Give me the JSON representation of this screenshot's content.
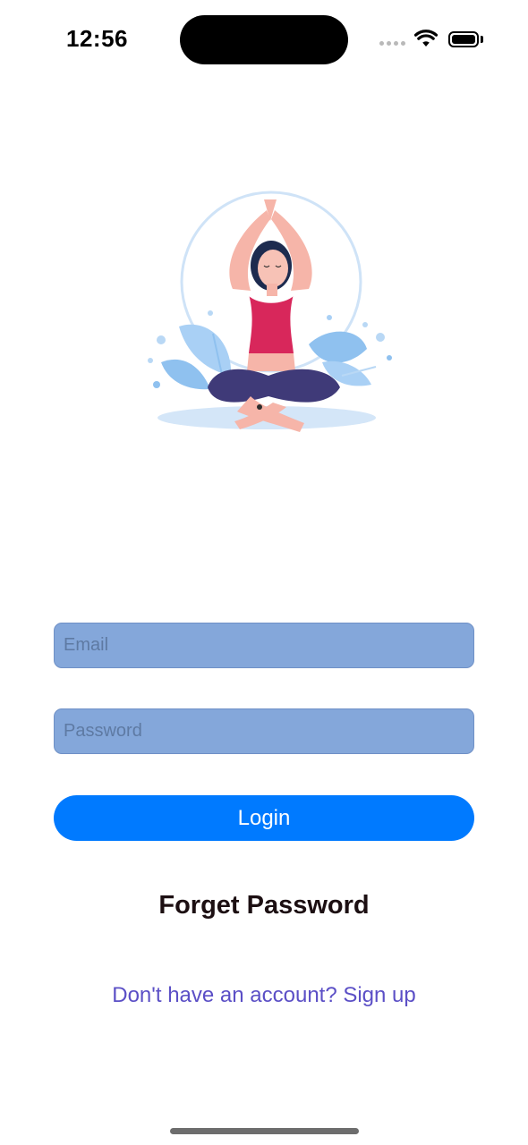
{
  "status_bar": {
    "time": "12:56",
    "icons": [
      "cellular-signal-icon",
      "wifi-icon",
      "battery-icon"
    ]
  },
  "illustration": {
    "name": "yoga-meditation-illustration"
  },
  "login_form": {
    "email_placeholder": "Email",
    "email_value": "",
    "password_placeholder": "Password",
    "password_value": "",
    "login_label": "Login",
    "forget_password_label": "Forget Password",
    "signup_prompt": "Don't have an account? Sign up"
  },
  "colors": {
    "field_background": "#84a7da",
    "login_button": "#007aff",
    "signup_link": "#5b4fc6",
    "forget_text": "#1c0f12"
  }
}
